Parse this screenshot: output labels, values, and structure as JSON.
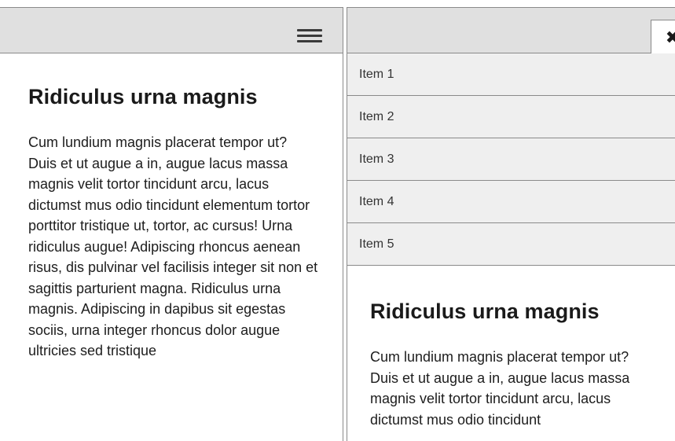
{
  "left_panel": {
    "menu_icon": "hamburger-icon",
    "title": "Ridiculus urna magnis",
    "body": "Cum lundium magnis placerat tempor ut? Duis et ut augue a in, augue lacus massa magnis velit tortor tincidunt arcu, lacus dictumst mus odio tincidunt elementum tortor porttitor tristique ut, tortor, ac cursus! Urna ridiculus augue! Adipiscing rhoncus aenean risus, dis pulvinar vel facilisis integer sit non et sagittis parturient magna. Ridiculus urna magnis. Adipiscing in dapibus sit egestas sociis, urna integer rhoncus dolor augue ultricies sed tristique"
  },
  "right_panel": {
    "close_icon": "close-icon",
    "close_label": "✖",
    "menu": {
      "items": [
        {
          "label": "Item 1"
        },
        {
          "label": "Item 2"
        },
        {
          "label": "Item 3"
        },
        {
          "label": "Item 4"
        },
        {
          "label": "Item 5"
        }
      ]
    },
    "title": "Ridiculus urna magnis",
    "body": "Cum lundium magnis placerat tempor ut? Duis et ut augue a in, augue lacus massa magnis velit tortor tincidunt arcu, lacus dictumst mus odio tincidunt"
  }
}
